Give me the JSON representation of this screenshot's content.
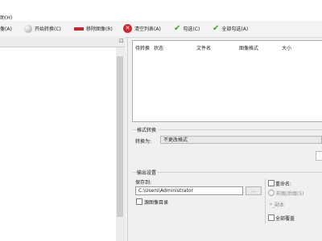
{
  "menu": {
    "partial_text": "助(H)"
  },
  "toolbar": {
    "items": [
      {
        "label": "像(A)",
        "icon": "add-image-icon"
      },
      {
        "label": "开始转换(C)",
        "icon": "start-convert-icon"
      },
      {
        "label": "移除图像(R)",
        "icon": "remove-image-icon"
      },
      {
        "label": "清空列表(A)",
        "icon": "clear-list-icon"
      },
      {
        "label": "勾选(C)",
        "icon": "check-icon"
      },
      {
        "label": "全部勾选(A)",
        "icon": "check-all-icon"
      }
    ]
  },
  "file_list": {
    "columns": [
      "待转换",
      "状态",
      "文件名",
      "图像格式",
      "大小"
    ]
  },
  "format_group": {
    "title": "格式转换",
    "convert_label": "转换为:",
    "selected_format": "不更改格式"
  },
  "output_group": {
    "title": "输出设置",
    "save_to_label": "保存到:",
    "save_path": "C:\\Users\\Administrator",
    "browse_label": "...",
    "overwrite_label": "源图像目录",
    "rename_label": "重命名:",
    "prefix_suffix_label": "前缀/后缀(S)",
    "name_pattern": "*_副本",
    "overwrite_all_label": "全部覆盖"
  },
  "colors": {
    "accent_red": "#d0262a",
    "check_green": "#2fa52f"
  }
}
